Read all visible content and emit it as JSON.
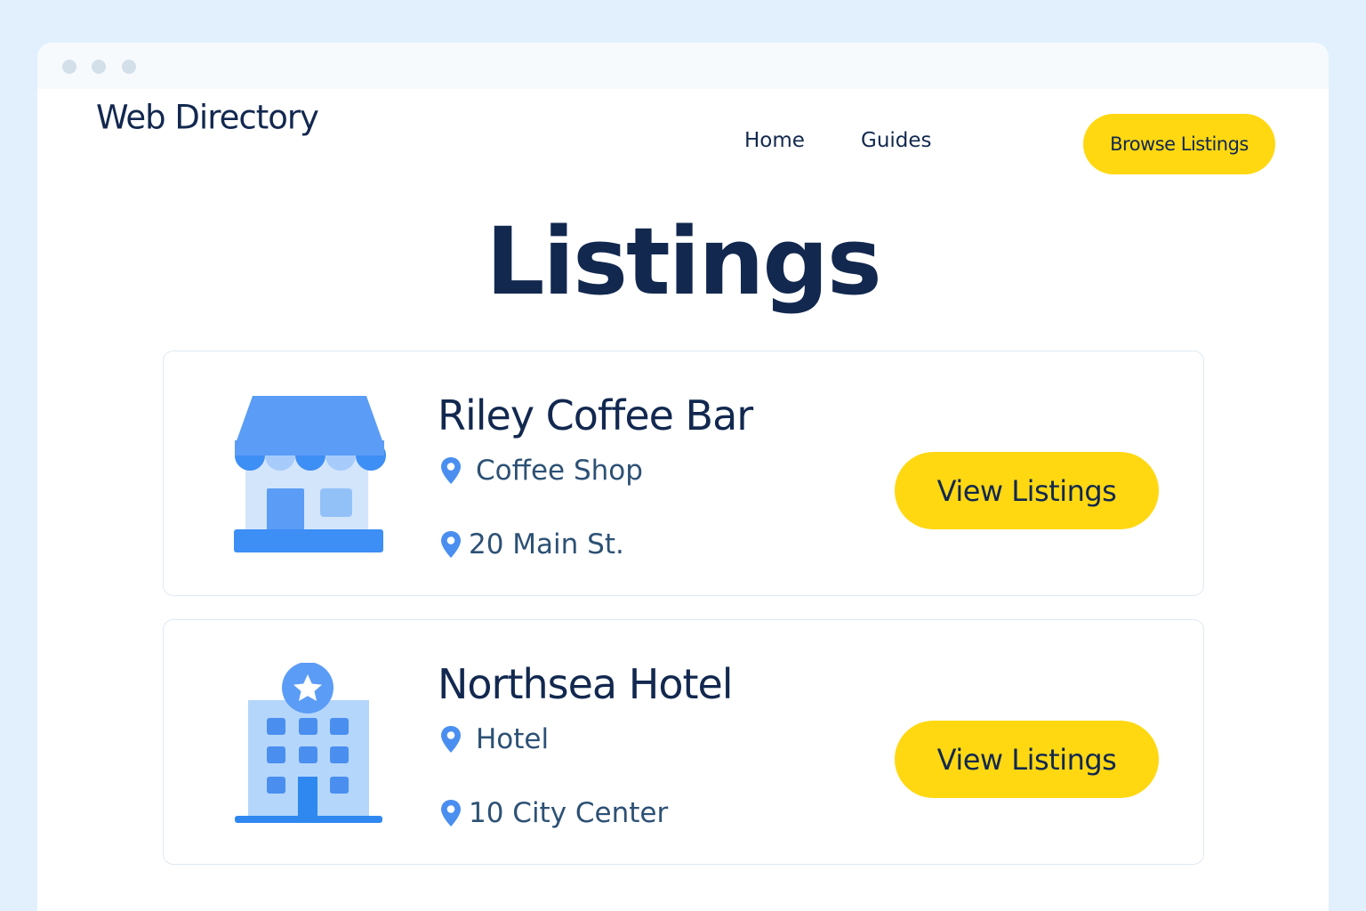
{
  "brand": "Web Directory",
  "nav": {
    "home": "Home",
    "guides": "Guides",
    "browse_button": "Browse Listings"
  },
  "page_title": "Listings",
  "listings": [
    {
      "name": "Riley Coffee Bar",
      "category": "Coffee Shop",
      "address": "20 Main St.",
      "button": "View Listings",
      "icon": "storefront-icon"
    },
    {
      "name": "Northsea Hotel",
      "category": "Hotel",
      "address": "10 City Center",
      "button": "View Listings",
      "icon": "hotel-building-icon"
    }
  ],
  "colors": {
    "background": "#e1f0fc",
    "accent_yellow": "#ffd812",
    "navy_text": "#12284f",
    "icon_blue": "#3d8ef5"
  }
}
